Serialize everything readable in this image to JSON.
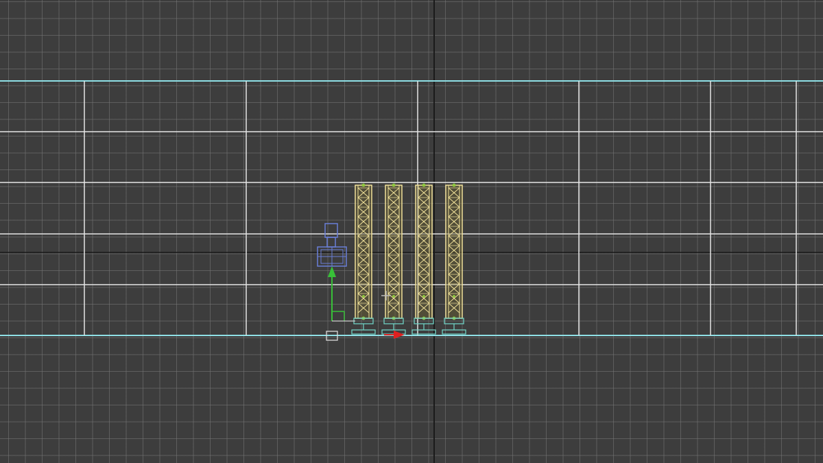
{
  "viewport": {
    "view": "front",
    "grid_visible": true
  },
  "colors": {
    "background": "#3d3d3d",
    "grid_minor": "#6f6f6f",
    "grid_major": "#111111",
    "selection_frame": "#8fe0e6",
    "frame_lines": "#e6e6e6",
    "truss_outline": "#f2e29a",
    "truss_fill": "#6b6233",
    "truss_joint": "#8cc63f",
    "base_plate": "#6fd1c3",
    "camera_body": "#6a7fd8",
    "gizmo_y": "#38c038",
    "gizmo_x": "#e02020"
  },
  "scene": {
    "truss_count": 4,
    "icons": [
      "camera-icon",
      "move-gizmo-icon",
      "pivot-box-icon",
      "cursor-icon"
    ]
  }
}
